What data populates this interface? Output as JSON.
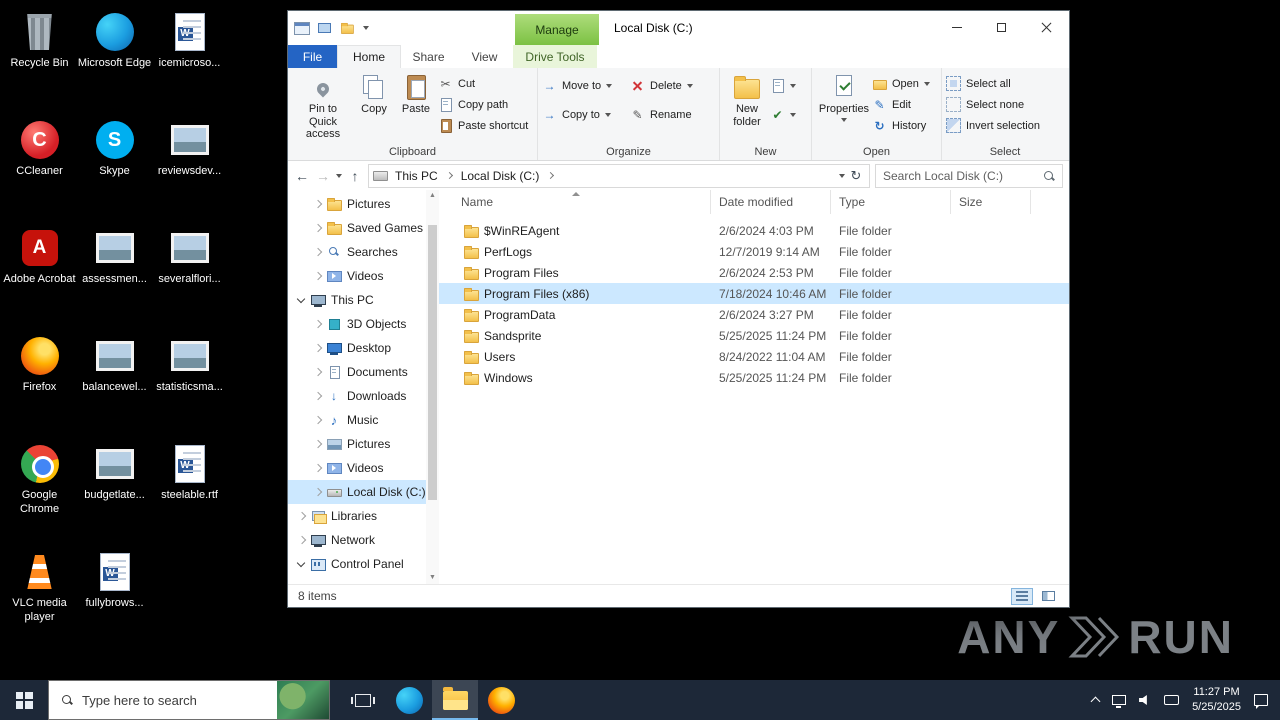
{
  "colors": {
    "taskbar": "#1d2838",
    "file_tab_blue": "#2464c4",
    "manage_green": "#7cc143",
    "selection_blue": "#cce8ff"
  },
  "desktop": {
    "icons": [
      {
        "label": "Recycle Bin"
      },
      {
        "label": "Microsoft Edge"
      },
      {
        "label": "icemicroso..."
      },
      {
        "label": "CCleaner"
      },
      {
        "label": "Skype"
      },
      {
        "label": "reviewsdev..."
      },
      {
        "label": "Adobe Acrobat"
      },
      {
        "label": "assessmen..."
      },
      {
        "label": "severalflori..."
      },
      {
        "label": "Firefox"
      },
      {
        "label": "balancewel..."
      },
      {
        "label": "statisticsma..."
      },
      {
        "label": "Google Chrome"
      },
      {
        "label": "budgetlate..."
      },
      {
        "label": "steelable.rtf"
      },
      {
        "label": "VLC media player"
      },
      {
        "label": "fullybrows..."
      }
    ]
  },
  "window": {
    "title": "Local Disk (C:)",
    "contextual_header": "Manage",
    "tabs": {
      "file": "File",
      "home": "Home",
      "share": "Share",
      "view": "View",
      "contextual": "Drive Tools"
    },
    "ribbon": {
      "clipboard": {
        "label": "Clipboard",
        "pin": "Pin to Quick access",
        "copy": "Copy",
        "paste": "Paste",
        "cut": "Cut",
        "copy_path": "Copy path",
        "paste_shortcut": "Paste shortcut"
      },
      "organize": {
        "label": "Organize",
        "move_to": "Move to",
        "copy_to": "Copy to",
        "delete": "Delete",
        "rename": "Rename"
      },
      "new": {
        "label": "New",
        "new_folder": "New folder"
      },
      "open_group": {
        "label": "Open",
        "properties": "Properties",
        "open": "Open",
        "edit": "Edit",
        "history": "History"
      },
      "select": {
        "label": "Select",
        "select_all": "Select all",
        "select_none": "Select none",
        "invert": "Invert selection"
      }
    },
    "address": {
      "segments": [
        "This PC",
        "Local Disk (C:)"
      ]
    },
    "search_placeholder": "Search Local Disk (C:)",
    "sidebar": {
      "items": [
        {
          "label": "Pictures"
        },
        {
          "label": "Saved Games"
        },
        {
          "label": "Searches"
        },
        {
          "label": "Videos"
        },
        {
          "label": "This PC"
        },
        {
          "label": "3D Objects"
        },
        {
          "label": "Desktop"
        },
        {
          "label": "Documents"
        },
        {
          "label": "Downloads"
        },
        {
          "label": "Music"
        },
        {
          "label": "Pictures"
        },
        {
          "label": "Videos"
        },
        {
          "label": "Local Disk (C:)"
        },
        {
          "label": "Libraries"
        },
        {
          "label": "Network"
        },
        {
          "label": "Control Panel"
        }
      ]
    },
    "files": {
      "columns": {
        "name": "Name",
        "date": "Date modified",
        "type": "Type",
        "size": "Size"
      },
      "rows": [
        {
          "name": "$WinREAgent",
          "date": "2/6/2024 4:03 PM",
          "type": "File folder"
        },
        {
          "name": "PerfLogs",
          "date": "12/7/2019 9:14 AM",
          "type": "File folder"
        },
        {
          "name": "Program Files",
          "date": "2/6/2024 2:53 PM",
          "type": "File folder"
        },
        {
          "name": "Program Files (x86)",
          "date": "7/18/2024 10:46 AM",
          "type": "File folder"
        },
        {
          "name": "ProgramData",
          "date": "2/6/2024 3:27 PM",
          "type": "File folder"
        },
        {
          "name": "Sandsprite",
          "date": "5/25/2025 11:24 PM",
          "type": "File folder"
        },
        {
          "name": "Users",
          "date": "8/24/2022 11:04 AM",
          "type": "File folder"
        },
        {
          "name": "Windows",
          "date": "5/25/2025 11:24 PM",
          "type": "File folder"
        }
      ]
    },
    "status": "8 items"
  },
  "taskbar": {
    "search_placeholder": "Type here to search",
    "clock": {
      "time": "11:27 PM",
      "date": "5/25/2025"
    }
  },
  "watermark": {
    "left": "ANY",
    "right": "RUN"
  }
}
